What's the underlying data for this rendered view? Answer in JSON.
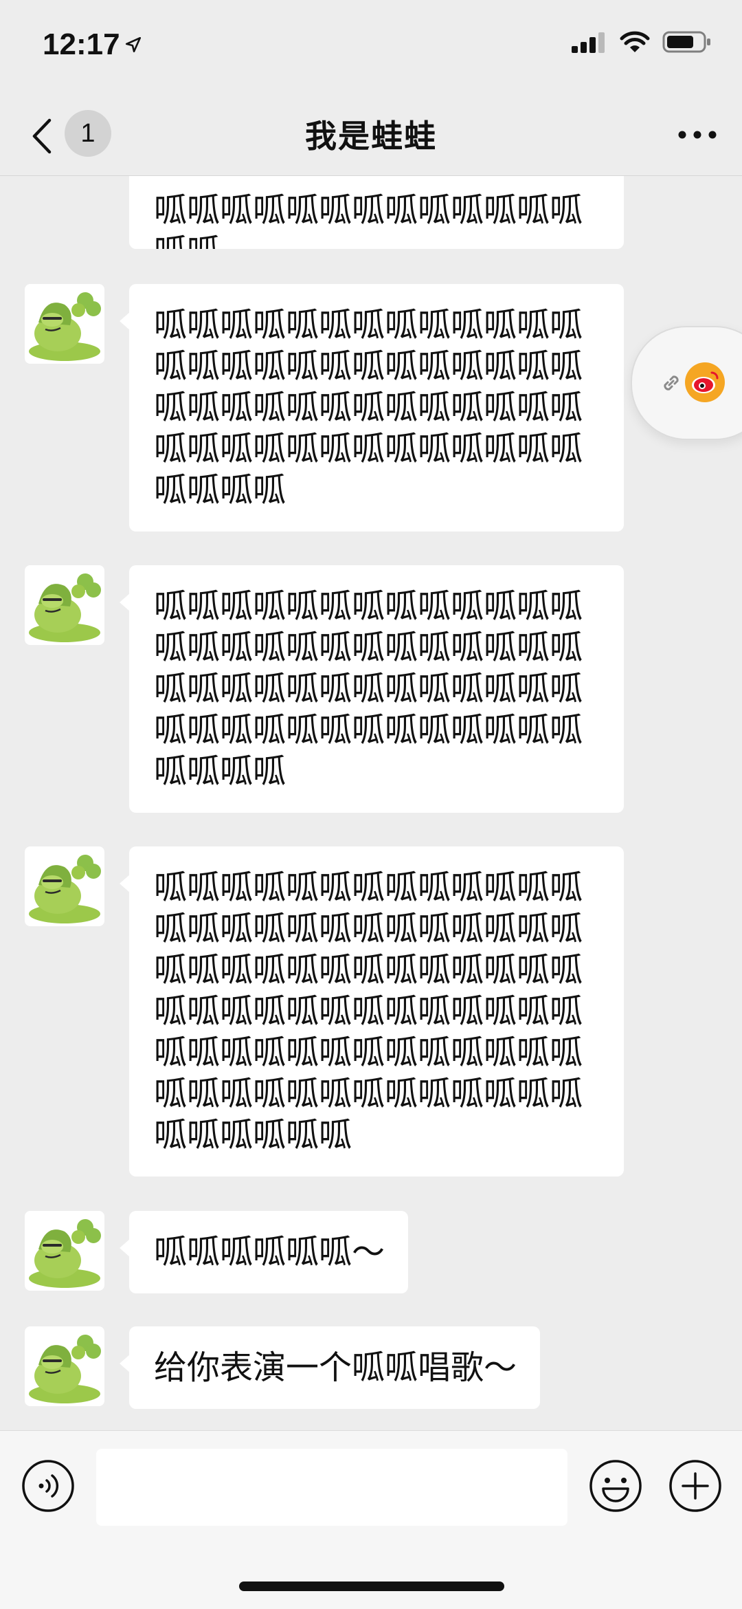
{
  "status_bar": {
    "time": "12:17"
  },
  "nav": {
    "unread_count": "1",
    "title": "我是蛙蛙"
  },
  "messages": [
    {
      "text": "呱呱呱呱呱呱呱呱呱呱呱呱呱\n呱呱"
    },
    {
      "text": "呱呱呱呱呱呱呱呱呱呱呱呱呱呱呱呱呱呱呱呱呱呱呱呱呱呱呱呱呱呱呱呱呱呱呱呱呱呱呱呱呱呱呱呱呱呱呱呱呱呱呱呱呱呱呱呱"
    },
    {
      "text": "呱呱呱呱呱呱呱呱呱呱呱呱呱呱呱呱呱呱呱呱呱呱呱呱呱呱呱呱呱呱呱呱呱呱呱呱呱呱呱呱呱呱呱呱呱呱呱呱呱呱呱呱呱呱呱呱"
    },
    {
      "text": "呱呱呱呱呱呱呱呱呱呱呱呱呱呱呱呱呱呱呱呱呱呱呱呱呱呱呱呱呱呱呱呱呱呱呱呱呱呱呱呱呱呱呱呱呱呱呱呱呱呱呱呱呱呱呱呱呱呱呱呱呱呱呱呱呱呱呱呱呱呱呱呱呱呱呱呱呱呱呱呱呱呱呱呱"
    },
    {
      "text": "呱呱呱呱呱呱～"
    },
    {
      "text": "给你表演一个呱呱唱歌～"
    }
  ],
  "input": {
    "placeholder": ""
  },
  "colors": {
    "background": "#ededed",
    "bubble": "#ffffff",
    "frog_green": "#9cc84a",
    "weibo_red": "#e6162d",
    "weibo_orange": "#f5a623"
  },
  "icons": {
    "back": "chevron-left-icon",
    "more": "more-dots-icon",
    "link": "link-icon",
    "weibo": "weibo-icon",
    "voice": "voice-icon",
    "emoji": "emoji-icon",
    "plus": "plus-icon"
  }
}
